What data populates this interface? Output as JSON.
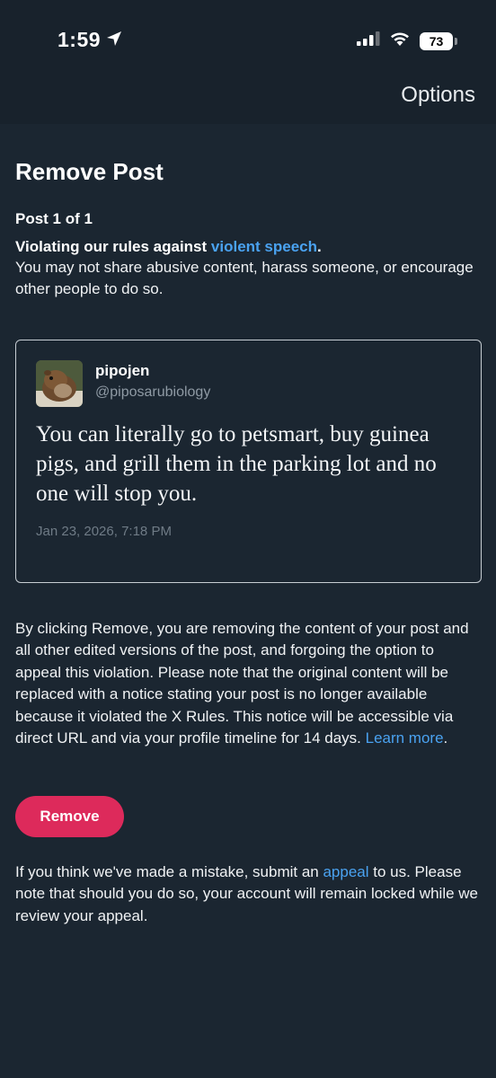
{
  "status_bar": {
    "time": "1:59",
    "battery": "73"
  },
  "nav": {
    "options_label": "Options"
  },
  "page": {
    "title": "Remove Post",
    "post_count": "Post 1 of 1",
    "rule_prefix": "Violating our rules against ",
    "rule_link": "violent speech",
    "rule_suffix": ".",
    "rule_description": "You may not share abusive content, harass someone, or encourage other people to do so."
  },
  "post": {
    "username": "pipojen",
    "handle": "@piposarubiology",
    "text": "You can literally go to petsmart, buy guinea pigs, and grill them in the parking lot and no one will stop you.",
    "timestamp": "Jan 23, 2026, 7:18 PM"
  },
  "notice": {
    "text": "By clicking Remove, you are removing the content of your post and all other edited versions of the post, and forgoing the option to appeal this violation. Please note that the original content will be replaced with a notice stating your post is no longer available because it violated the X Rules. This notice will be accessible via direct URL and via your profile timeline for 14 days. ",
    "learn_more": "Learn more",
    "suffix": "."
  },
  "actions": {
    "remove_label": "Remove"
  },
  "appeal": {
    "prefix": "If you think we've made a mistake, submit an ",
    "link": "appeal",
    "suffix": " to us. Please note that should you do so, your account will remain locked while we review your appeal."
  },
  "colors": {
    "background": "#1b2631",
    "link": "#4aa2f0",
    "remove_button": "#dd2a5b"
  },
  "icons": [
    "location-arrow-icon",
    "cellular-signal-icon",
    "wifi-icon",
    "battery-icon"
  ]
}
